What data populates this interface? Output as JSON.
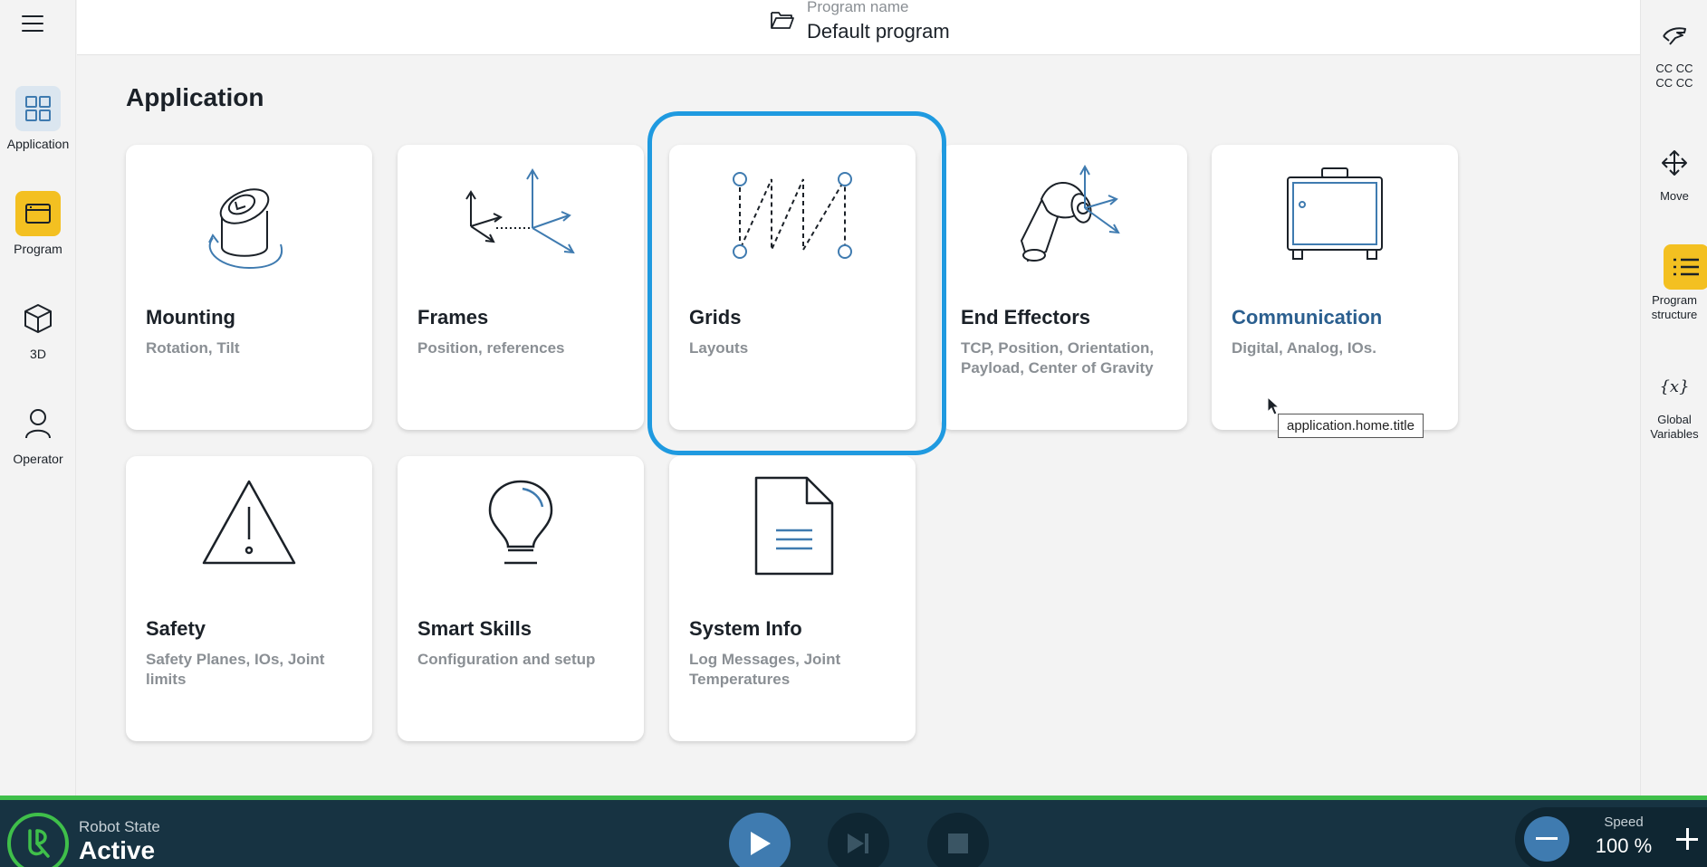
{
  "header": {
    "program_caption": "Program name",
    "program_name": "Default program"
  },
  "left_nav": {
    "items": [
      {
        "label": "Application",
        "icon": "grid-icon",
        "active": true
      },
      {
        "label": "Program",
        "icon": "program-window-icon"
      },
      {
        "label": "3D",
        "icon": "cube-icon"
      },
      {
        "label": "Operator",
        "icon": "person-icon"
      }
    ]
  },
  "right_nav": {
    "items": [
      {
        "label": "CC CC CC CC",
        "icon": "freedrive-hand-icon"
      },
      {
        "label": "Move",
        "icon": "move-arrows-icon"
      },
      {
        "label": "Program structure",
        "icon": "list-icon",
        "active": true
      },
      {
        "label": "Global Variables",
        "icon": "variable-x-icon"
      }
    ]
  },
  "main": {
    "title": "Application",
    "cards": [
      {
        "title": "Mounting",
        "subtitle": "Rotation, Tilt",
        "icon": "mounting-icon"
      },
      {
        "title": "Frames",
        "subtitle": "Position, references",
        "icon": "frames-icon"
      },
      {
        "title": "Grids",
        "subtitle": "Layouts",
        "icon": "grids-icon",
        "focused": true
      },
      {
        "title": "End Effectors",
        "subtitle": "TCP, Position, Orientation, Payload, Center of Gravity",
        "icon": "robot-tool-icon"
      },
      {
        "title": "Communication",
        "subtitle": "Digital, Analog, IOs.",
        "icon": "io-box-icon",
        "hovered": true
      },
      {
        "title": "Safety",
        "subtitle": "Safety Planes, IOs, Joint limits",
        "icon": "warning-triangle-icon"
      },
      {
        "title": "Smart Skills",
        "subtitle": "Configuration and setup",
        "icon": "lightbulb-icon"
      },
      {
        "title": "System Info",
        "subtitle": "Log Messages, Joint Temperatures",
        "icon": "document-icon"
      }
    ],
    "tooltip": "application.home.title"
  },
  "footer": {
    "robot_state_caption": "Robot State",
    "robot_state": "Active",
    "speed_caption": "Speed",
    "speed_value": "100 %"
  },
  "colors": {
    "accent_yellow": "#f3c021",
    "focus_blue": "#1f9ae0",
    "footer_bg": "#173342",
    "status_green": "#3fbf4a",
    "illustration_blue": "#3f7bb0"
  }
}
